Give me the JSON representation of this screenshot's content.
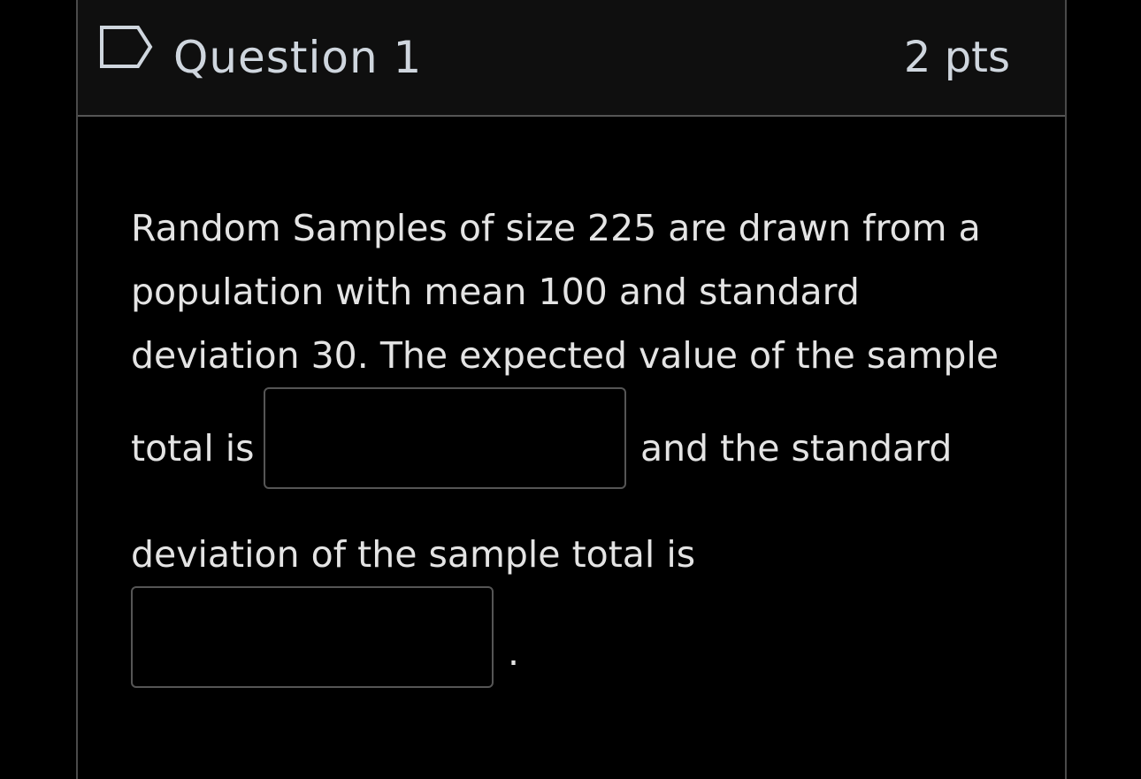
{
  "question": {
    "title": "Question 1",
    "points": "2 pts",
    "flag_icon": "flag-outline-icon",
    "lines": {
      "line1": "Random Samples of size 225 are drawn from a",
      "line2": "population with mean 100 and standard",
      "line3": "deviation 30. The expected value of the sample",
      "line4_before": "total is",
      "line4_after": "and the standard",
      "line5": "deviation of the sample total is",
      "end_punct": "."
    },
    "answers": {
      "blank1": "",
      "blank2": ""
    }
  },
  "colors": {
    "background": "#000000",
    "header_bg": "#0f0f0f",
    "border": "#555555",
    "title_text": "#cfd6de",
    "body_text": "#e4e4e4"
  }
}
